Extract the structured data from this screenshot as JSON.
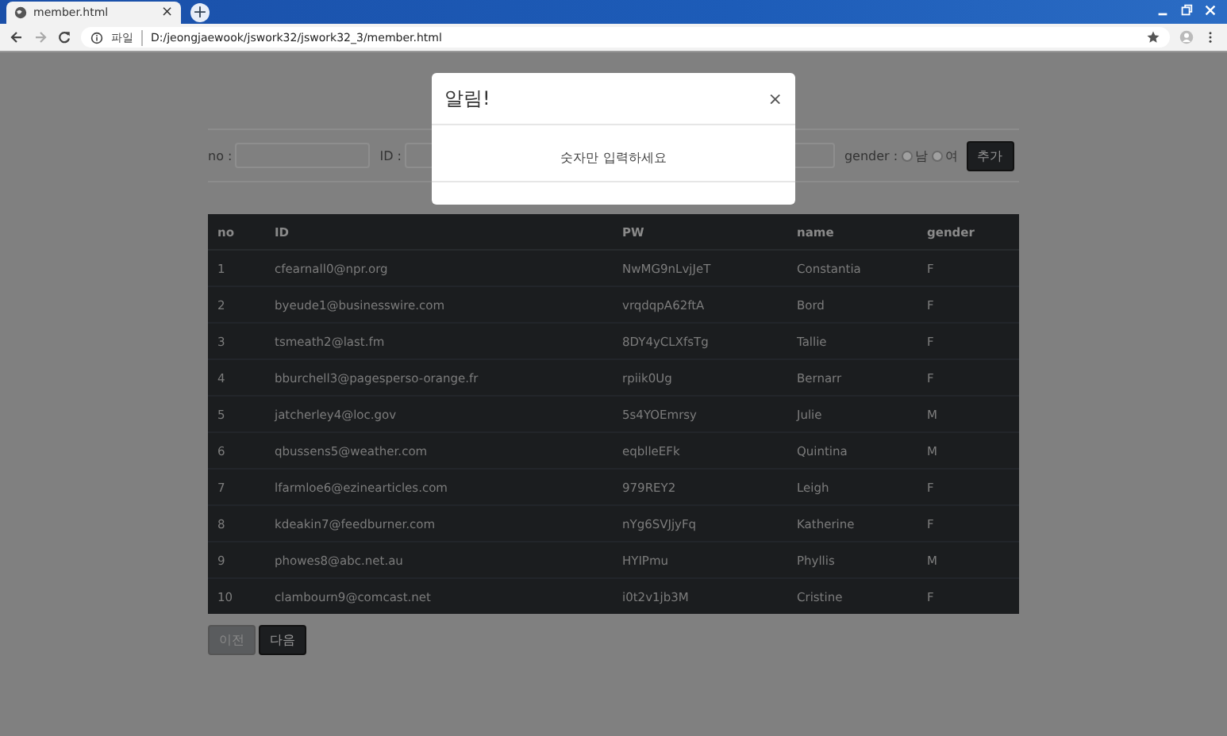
{
  "browser": {
    "tab_title": "member.html",
    "tab_close": "×",
    "new_tab": "+",
    "scheme_label": "파일",
    "url": "D:/jeongjaewook/jswork32/jswork32_3/member.html"
  },
  "form": {
    "fields": [
      {
        "kind": "labeled",
        "label": "no :"
      },
      {
        "kind": "labeled",
        "label": "ID :"
      },
      {
        "kind": "bare"
      }
    ],
    "gender_label": "gender :",
    "gender_options": [
      {
        "label": "남",
        "selected": false
      },
      {
        "label": "여",
        "selected": false
      }
    ],
    "add_button": "추가"
  },
  "table": {
    "columns": [
      "no",
      "ID",
      "PW",
      "name",
      "gender"
    ],
    "rows": [
      [
        "1",
        "cfearnall0@npr.org",
        "NwMG9nLvjJeT",
        "Constantia",
        "F"
      ],
      [
        "2",
        "byeude1@businesswire.com",
        "vrqdqpA62ftA",
        "Bord",
        "F"
      ],
      [
        "3",
        "tsmeath2@last.fm",
        "8DY4yCLXfsTg",
        "Tallie",
        "F"
      ],
      [
        "4",
        "bburchell3@pagesperso-orange.fr",
        "rpiik0Ug",
        "Bernarr",
        "F"
      ],
      [
        "5",
        "jatcherley4@loc.gov",
        "5s4YOEmrsy",
        "Julie",
        "M"
      ],
      [
        "6",
        "qbussens5@weather.com",
        "eqblleEFk",
        "Quintina",
        "M"
      ],
      [
        "7",
        "lfarmloe6@ezinearticles.com",
        "979REY2",
        "Leigh",
        "F"
      ],
      [
        "8",
        "kdeakin7@feedburner.com",
        "nYg6SVJjyFq",
        "Katherine",
        "F"
      ],
      [
        "9",
        "phowes8@abc.net.au",
        "HYIPmu",
        "Phyllis",
        "M"
      ],
      [
        "10",
        "clambourn9@comcast.net",
        "i0t2v1jb3M",
        "Cristine",
        "F"
      ]
    ]
  },
  "pager": [
    {
      "label": "이전",
      "disabled": true
    },
    {
      "label": "다음",
      "disabled": false
    }
  ],
  "modal": {
    "title": "알림!",
    "close": "×",
    "message": "숫자만 입력하세요"
  }
}
